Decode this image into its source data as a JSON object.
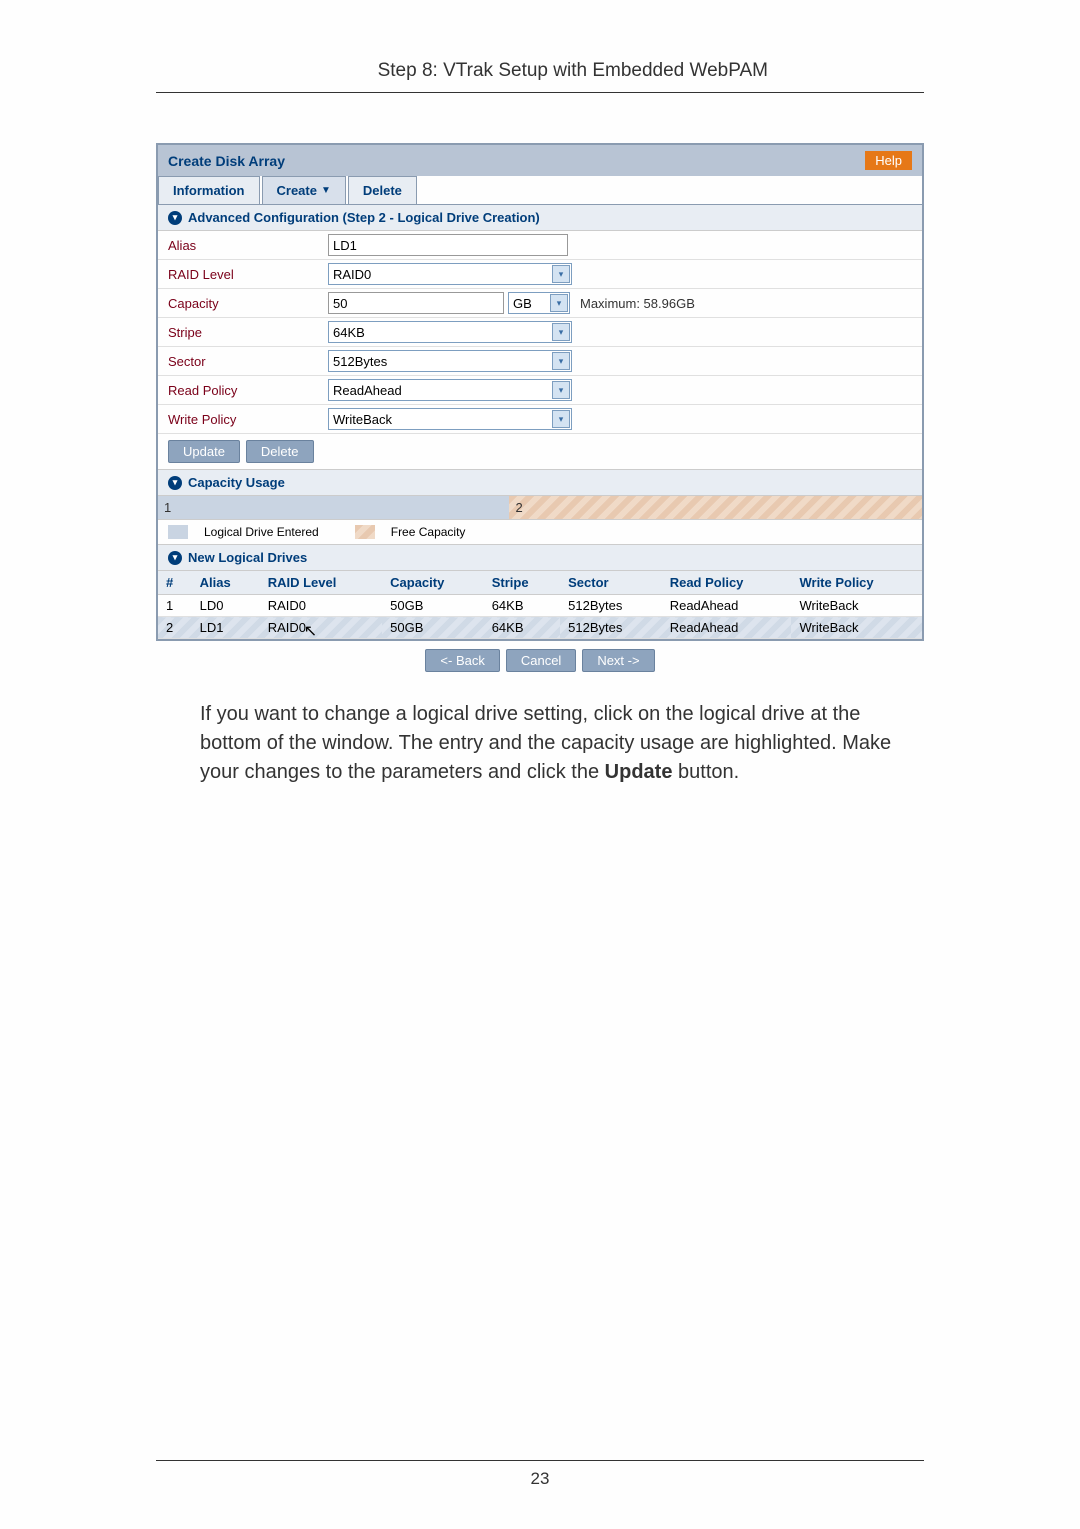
{
  "page": {
    "header": "Step 8: VTrak Setup with Embedded WebPAM",
    "number": "23"
  },
  "panel": {
    "title": "Create Disk Array",
    "help": "Help"
  },
  "tabs": {
    "information": "Information",
    "create": "Create",
    "delete": "Delete"
  },
  "step2": {
    "header": "Advanced Configuration (Step 2 - Logical Drive Creation)",
    "rows": {
      "alias": {
        "label": "Alias",
        "value": "LD1"
      },
      "raid": {
        "label": "RAID Level",
        "value": "RAID0"
      },
      "capacity": {
        "label": "Capacity",
        "value": "50",
        "unit": "GB",
        "max": "Maximum: 58.96GB"
      },
      "stripe": {
        "label": "Stripe",
        "value": "64KB"
      },
      "sector": {
        "label": "Sector",
        "value": "512Bytes"
      },
      "read": {
        "label": "Read Policy",
        "value": "ReadAhead"
      },
      "write": {
        "label": "Write Policy",
        "value": "WriteBack"
      }
    },
    "buttons": {
      "update": "Update",
      "delete": "Delete"
    }
  },
  "capacityUsage": {
    "header": "Capacity Usage",
    "block1": "1",
    "block2": "2",
    "legend": {
      "entered": "Logical Drive Entered",
      "free": "Free Capacity"
    }
  },
  "newDrives": {
    "header": "New Logical Drives",
    "columns": {
      "num": "#",
      "alias": "Alias",
      "raid": "RAID Level",
      "cap": "Capacity",
      "stripe": "Stripe",
      "sector": "Sector",
      "read": "Read Policy",
      "write": "Write Policy"
    },
    "rows": [
      {
        "num": "1",
        "alias": "LD0",
        "raid": "RAID0",
        "cap": "50GB",
        "stripe": "64KB",
        "sector": "512Bytes",
        "read": "ReadAhead",
        "write": "WriteBack"
      },
      {
        "num": "2",
        "alias": "LD1",
        "raid": "RAID0",
        "cap": "50GB",
        "stripe": "64KB",
        "sector": "512Bytes",
        "read": "ReadAhead",
        "write": "WriteBack"
      }
    ]
  },
  "navButtons": {
    "back": "<- Back",
    "cancel": "Cancel",
    "next": "Next ->"
  },
  "bodyText": {
    "part1": "If you want to change a logical drive setting, click on the logical drive at the bottom of the window. The entry and the capacity usage are highlighted. Make your changes to the parameters and click the ",
    "bold": "Update",
    "part2": " button."
  }
}
